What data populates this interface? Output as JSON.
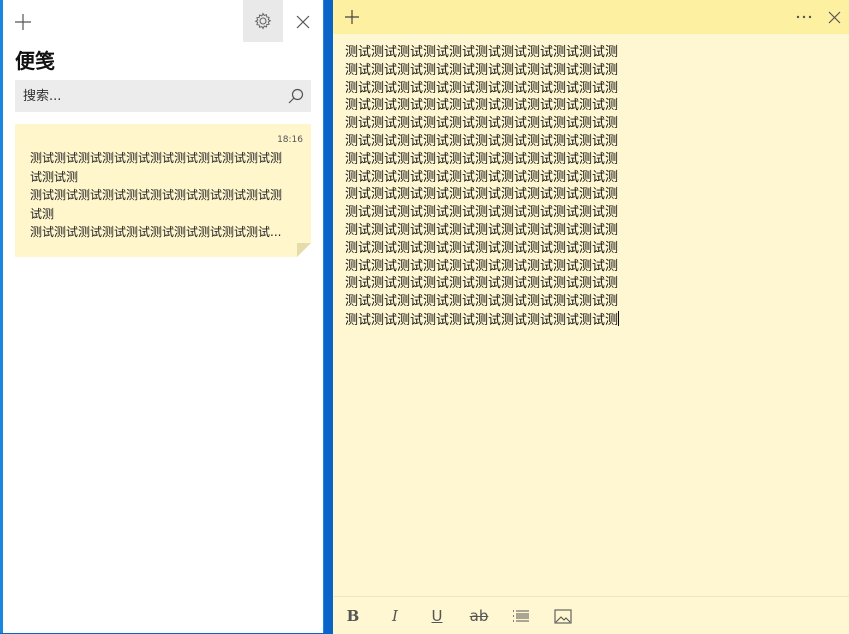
{
  "left_window": {
    "title": "便笺",
    "search": {
      "placeholder": "搜索..."
    },
    "note_card": {
      "time": "18:16",
      "lines": [
        "测试测试测试测试测试测试测试测试测试测试测",
        "试测试测",
        "测试测试测试测试测试测试测试测试测试测试测",
        "试测",
        "测试测试测试测试测试测试测试测试测试测试..."
      ]
    }
  },
  "right_window": {
    "note_text": "测试测试测试测试测试测试测试测试测试测试测\n测试测试测试测试测试测试测试测试测试测试测\n测试测试测试测试测试测试测试测试测试测试测\n测试测试测试测试测试测试测试测试测试测试测\n测试测试测试测试测试测试测试测试测试测试测\n测试测试测试测试测试测试测试测试测试测试测\n测试测试测试测试测试测试测试测试测试测试测\n测试测试测试测试测试测试测试测试测试测试测\n测试测试测试测试测试测试测试测试测试测试测\n测试测试测试测试测试测试测试测试测试测试测\n测试测试测试测试测试测试测试测试测试测试测\n测试测试测试测试测试测试测试测试测试测试测\n测试测试测试测试测试测试测试测试测试测试测\n测试测试测试测试测试测试测试测试测试测试测\n测试测试测试测试测试测试测试测试测试测试测\n测试测试测试测试测试测试测试测试测试测试测",
    "toolbar": {
      "bold": "B",
      "italic": "I",
      "underline": "U",
      "strikethrough": "ab"
    }
  },
  "colors": {
    "note_yellow": "#fff7d1",
    "note_header": "#fdf0a0",
    "desktop_blue": "#0a64c8"
  },
  "icons": [
    "plus-icon",
    "gear-icon",
    "close-icon",
    "search-icon",
    "more-icon",
    "bullet-list-icon",
    "image-icon"
  ]
}
